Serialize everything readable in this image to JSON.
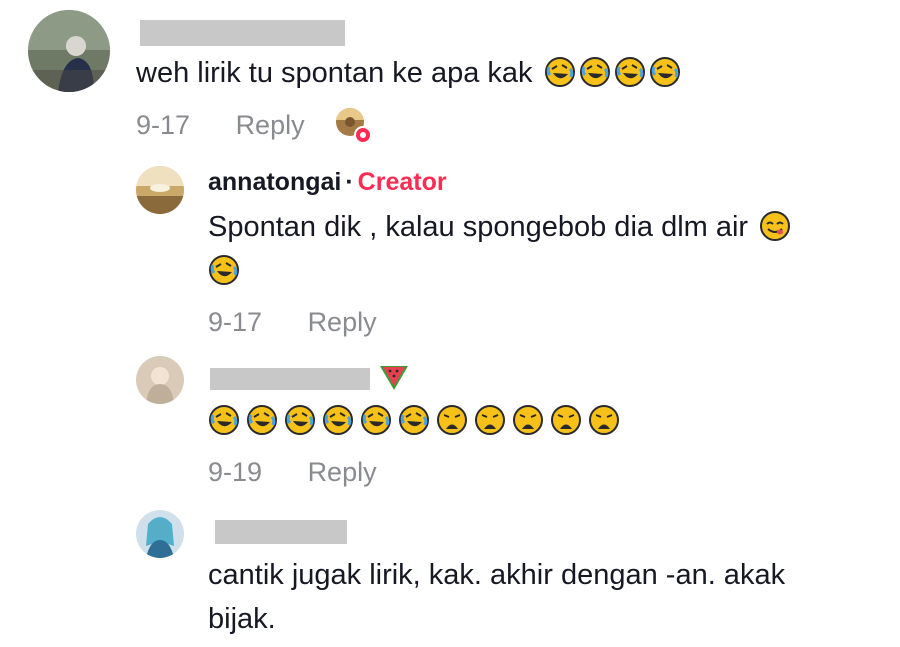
{
  "comments": [
    {
      "text": "weh lirik tu spontan ke apa kak",
      "emojis": [
        "rofl-emoji",
        "rofl-emoji",
        "rofl-emoji",
        "rofl-emoji"
      ],
      "date": "9-17",
      "reply_label": "Reply"
    },
    {
      "username": "annatongai",
      "separator": "·",
      "badge": "Creator",
      "text_line1": "Spontan dik , kalau spongebob dia dlm air",
      "date": "9-17",
      "reply_label": "Reply"
    },
    {
      "emoji_row": [
        "rofl",
        "rofl",
        "rofl",
        "rofl",
        "rofl",
        "rofl",
        "weary",
        "weary",
        "weary",
        "weary",
        "weary"
      ],
      "date": "9-19",
      "reply_label": "Reply"
    },
    {
      "text_line1": "cantik jugak lirik, kak. akhir dengan -an. akak",
      "text_line2": "bijak."
    }
  ]
}
